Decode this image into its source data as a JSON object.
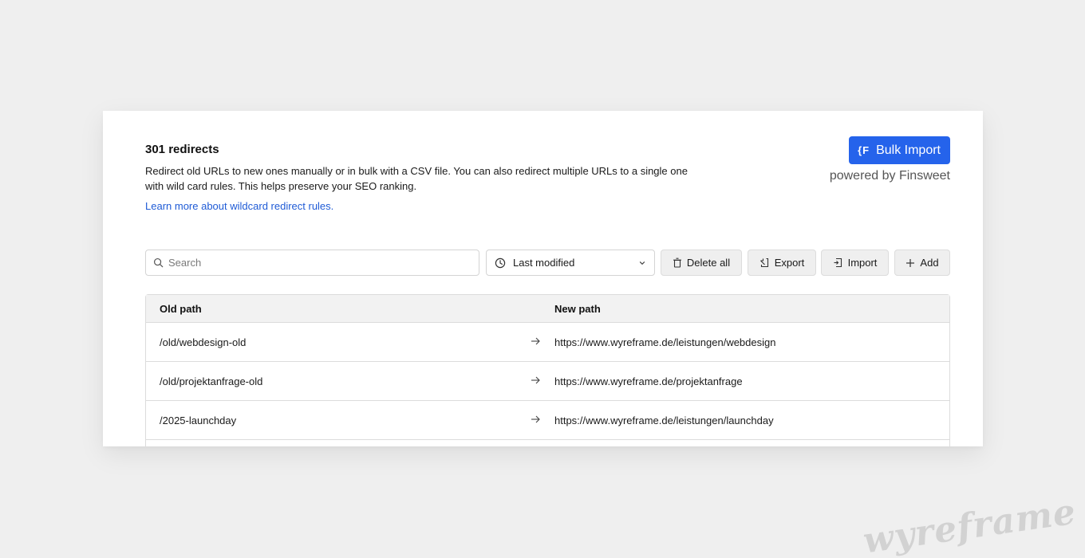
{
  "header": {
    "title": "301 redirects",
    "description": "Redirect old URLs to new ones manually or in bulk with a CSV file. You can also redirect multiple URLs to a single one with wild card rules. This helps preserve your SEO ranking.",
    "learn_link": "Learn more about wildcard redirect rules."
  },
  "bulk_import": {
    "logo_text": "{F",
    "label": "Bulk Import",
    "powered_by": "powered by Finsweet"
  },
  "toolbar": {
    "search_placeholder": "Search",
    "sort_selected": "Last modified",
    "delete_label": "Delete all",
    "export_label": "Export",
    "import_label": "Import",
    "add_label": "Add"
  },
  "table": {
    "headers": {
      "old": "Old path",
      "new": "New path"
    },
    "rows": [
      {
        "old": "/old/webdesign-old",
        "new": "https://www.wyreframe.de/leistungen/webdesign"
      },
      {
        "old": "/old/projektanfrage-old",
        "new": "https://www.wyreframe.de/projektanfrage"
      },
      {
        "old": "/2025-launchday",
        "new": "https://www.wyreframe.de/leistungen/launchday"
      }
    ]
  },
  "watermark": "wyreframe",
  "colors": {
    "accent": "#2563eb",
    "link": "#1f5bd6",
    "background": "#efefef"
  },
  "icons": [
    "search-icon",
    "clock-icon",
    "chevron-down-icon",
    "trash-icon",
    "export-icon",
    "import-icon",
    "plus-icon",
    "arrow-right-icon"
  ]
}
